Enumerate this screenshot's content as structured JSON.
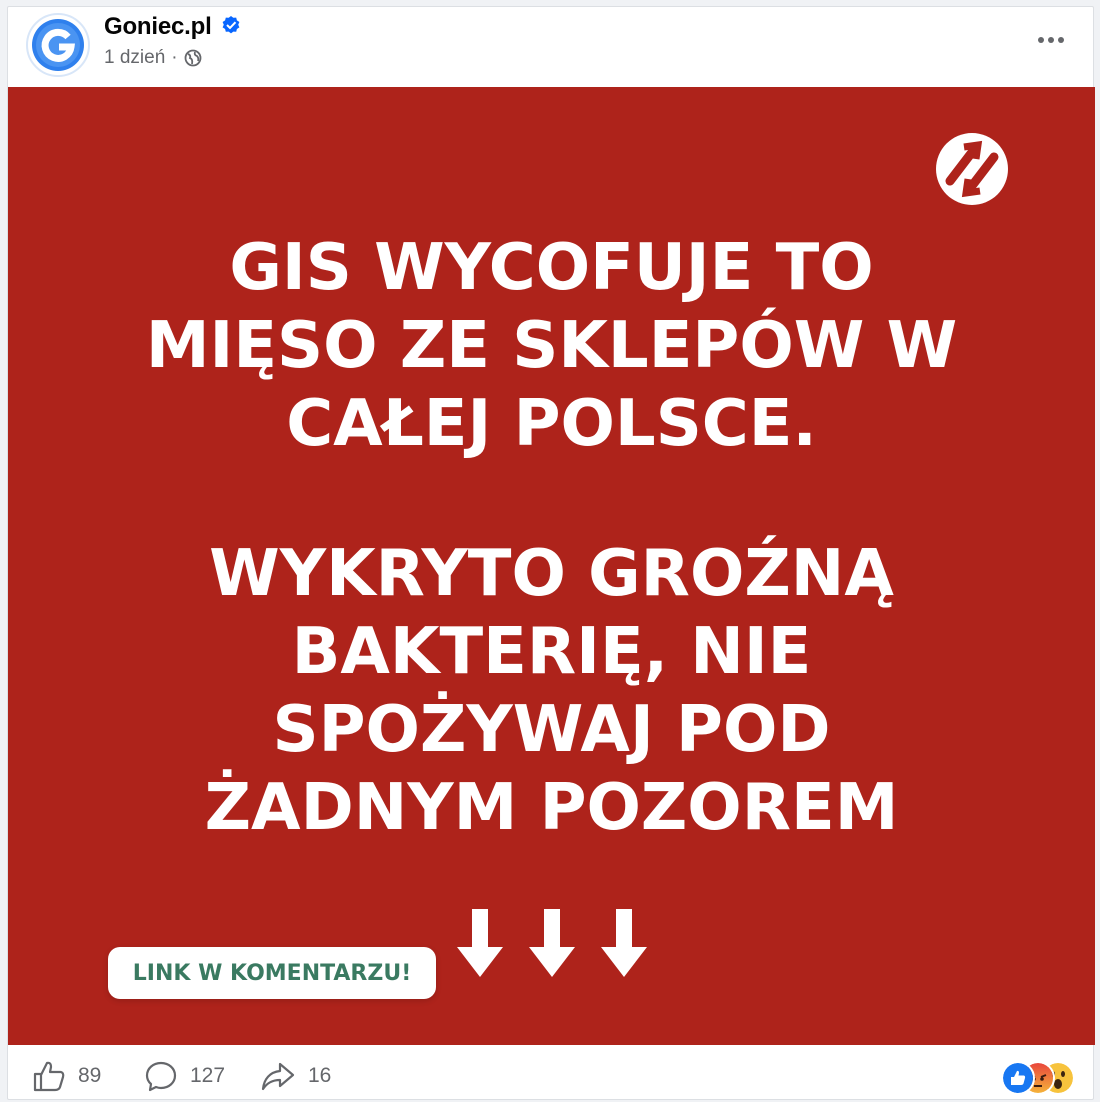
{
  "post": {
    "page_name": "Goniec.pl",
    "time_ago": "1 dzień",
    "separator": "·",
    "image": {
      "headline_1": "GIS WYCOFUJE TO\nMIĘSO ZE SKLEPÓW W\nCAŁEJ POLSCE.",
      "headline_2": "WYKRYTO GROŹNĄ\nBAKTERIĘ, NIE\nSPOŻYWAJ POD\nŻADNYM POZOREM",
      "cta": "LINK W KOMENTARZU!",
      "background_color": "#ae231b"
    },
    "footer": {
      "likes": "89",
      "comments": "127",
      "shares": "16"
    }
  },
  "colors": {
    "brand_blue": "#2f80ed",
    "verified": "#0866ff",
    "cta_text": "#3a7a61"
  },
  "icons": [
    "avatar-g-logo",
    "verified-badge-icon",
    "globe-icon",
    "more-icon",
    "like-icon",
    "comment-icon",
    "share-icon",
    "like-reaction-icon",
    "angry-reaction-icon",
    "wow-reaction-icon"
  ]
}
